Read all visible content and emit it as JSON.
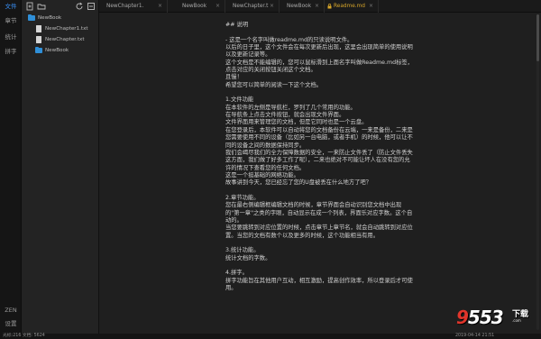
{
  "rail": {
    "items": [
      {
        "label": "文件",
        "active": true
      },
      {
        "label": "章节",
        "active": false
      },
      {
        "label": "统计",
        "active": false
      },
      {
        "label": "拼字",
        "active": false
      }
    ],
    "bottom": [
      {
        "label": "ZEN"
      },
      {
        "label": "设置"
      }
    ]
  },
  "sidebar": {
    "toolbar_icons": [
      "new-file-icon",
      "new-folder-icon",
      "refresh-icon",
      "collapse-icon"
    ],
    "tree": [
      {
        "label": "NewBook",
        "type": "folder",
        "level": 0
      },
      {
        "label": "NewChapter1.txt",
        "type": "file",
        "level": 1
      },
      {
        "label": "NewChapter.txt",
        "type": "file",
        "level": 1
      },
      {
        "label": "NewBook",
        "type": "folder",
        "level": 1
      }
    ]
  },
  "tabs": [
    {
      "label": "NewChapter1.",
      "active": false
    },
    {
      "label": "NewBook",
      "active": false
    },
    {
      "label": "NewChapter.t",
      "active": false
    },
    {
      "label": "NewBook",
      "active": false
    },
    {
      "label": "Readme.md",
      "active": true
    }
  ],
  "editor": {
    "content": "## 说明\n\n- 这是一个名字叫做readme.md的只读说明文件。\n以后的日子里，这个文件会在每次更新后出现，这里会出现简单的使用说明以及更新记录等。\n这个文档是不能编辑的，您可以鼠标滑到上面名字叫做Readme.md标签，点击对应的关闭按钮关闭这个文档。\n且慢！\n希望您可以简单的阅读一下这个文档。\n\n1.文件功能\n在本软件的左侧是导航栏，罗列了几个常用的功能。\n在导航条上点击文件按钮，就会出现文件界面。\n文件界面用来管理您的文档，但是它同时也是一个云盘。\n在您登录后，本软件可以自动将您的文档备份在云端，一来是备份，二来是您需要使用不同的设备（比如另一台电脑，或者手机）的时候，他可以让不同的设备之间的数据保持同步。\n我们会竭尽我们的全力保障数据的安全，一来防止文件丢了（防止文件丢失这方面，我们做了好多工作了呢），二来也绝对不可能让坏人在没有您的允许的情况下查看您的任何文档。\n这是一个挺基础的网络功能。\n故事讲到今天，您已经忘了您的U盘被丢在什么地方了吧？\n\n2.章节功能。\n您在最右侧编辑框编辑文档的时候，章节界面会自动识别您文档中出现的\"第一章\"之类的字眼，自动显示在成一个列表，界面乐对应字数。这个自动的。\n当您要跳转到对应位置的时候，点击章节上章节名，就会自动跳转到对应位置。当您的文档有数个以及更多的时候，这个功能相当有用。\n\n3.统计功能。\n统计文档的字数。\n\n4.拼字。\n拼字功能旨在其他用户互动，相互激励，提高创作效率，所以登录后才可使用。"
  },
  "status": {
    "left": "光标:216  文档: 5624",
    "right": "2019-04-14 21:51"
  },
  "watermark": {
    "big_a": "9",
    "big_b": "553",
    "small": "下载",
    "url": ".com"
  }
}
